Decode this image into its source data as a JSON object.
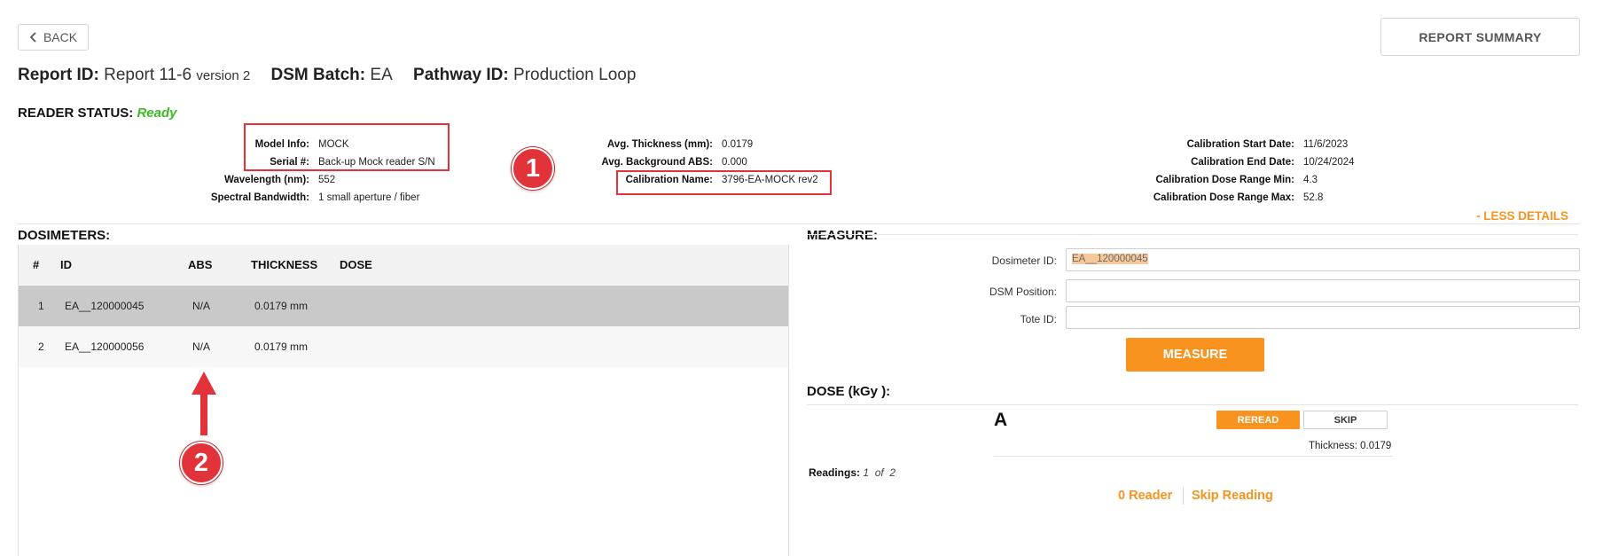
{
  "top": {
    "back_label": "BACK",
    "summary_label": "REPORT SUMMARY"
  },
  "report": {
    "report_id_label": "Report ID:",
    "report_id_value": "Report 11-6",
    "version": "version 2",
    "dsm_batch_label": "DSM Batch:",
    "dsm_batch_value": "EA",
    "pathway_id_label": "Pathway ID:",
    "pathway_id_value": "Production Loop"
  },
  "reader_status": {
    "label": "READER STATUS:",
    "value": "Ready"
  },
  "info": {
    "model_info": {
      "label": "Model Info:",
      "value": "MOCK"
    },
    "serial": {
      "label": "Serial #:",
      "value": "Back-up Mock reader S/N"
    },
    "wavelength": {
      "label": "Wavelength (nm):",
      "value": "552"
    },
    "bandwidth": {
      "label": "Spectral Bandwidth:",
      "value": "1 small aperture / fiber"
    },
    "avg_thickness": {
      "label": "Avg. Thickness (mm):",
      "value": "0.0179"
    },
    "avg_background": {
      "label": "Avg. Background ABS:",
      "value": "0.000"
    },
    "calibration_name": {
      "label": "Calibration Name:",
      "value": "3796-EA-MOCK rev2"
    },
    "cal_start": {
      "label": "Calibration Start Date:",
      "value": "11/6/2023"
    },
    "cal_end": {
      "label": "Calibration End Date:",
      "value": "10/24/2024"
    },
    "cal_min": {
      "label": "Calibration Dose Range Min:",
      "value": "4.3"
    },
    "cal_max": {
      "label": "Calibration Dose Range Max:",
      "value": "52.8"
    }
  },
  "less_details": "- LESS DETAILS",
  "dosimeters": {
    "title": "DOSIMETERS:",
    "columns": [
      "#",
      "ID",
      "ABS",
      "THICKNESS",
      "DOSE"
    ],
    "rows": [
      {
        "num": "1",
        "id": "EA__120000045",
        "abs": "N/A",
        "thickness": "0.0179 mm",
        "dose": ""
      },
      {
        "num": "2",
        "id": "EA__120000056",
        "abs": "N/A",
        "thickness": "0.0179 mm",
        "dose": ""
      }
    ]
  },
  "measure": {
    "title": "MEASURE:",
    "dosimeter_id_label": "Dosimeter ID:",
    "dosimeter_id_value": "EA__120000045",
    "dsm_position_label": "DSM Position:",
    "dsm_position_value": "",
    "tote_id_label": "Tote ID:",
    "tote_id_value": "",
    "button_label": "MEASURE"
  },
  "dose": {
    "title": "DOSE (kGy ):",
    "letter": "A",
    "reread_label": "REREAD",
    "skip_label": "SKIP",
    "thickness_text": "Thickness: 0.0179",
    "readings_label": "Readings:",
    "readings_value": "1  of  2",
    "zero_reader": "0 Reader",
    "skip_reading": "Skip Reading"
  },
  "annotations": {
    "badge1": "1",
    "badge2": "2"
  },
  "colors": {
    "accent": "#f7931e",
    "ready": "#3dbb27",
    "annotation_red": "#e2333b"
  }
}
